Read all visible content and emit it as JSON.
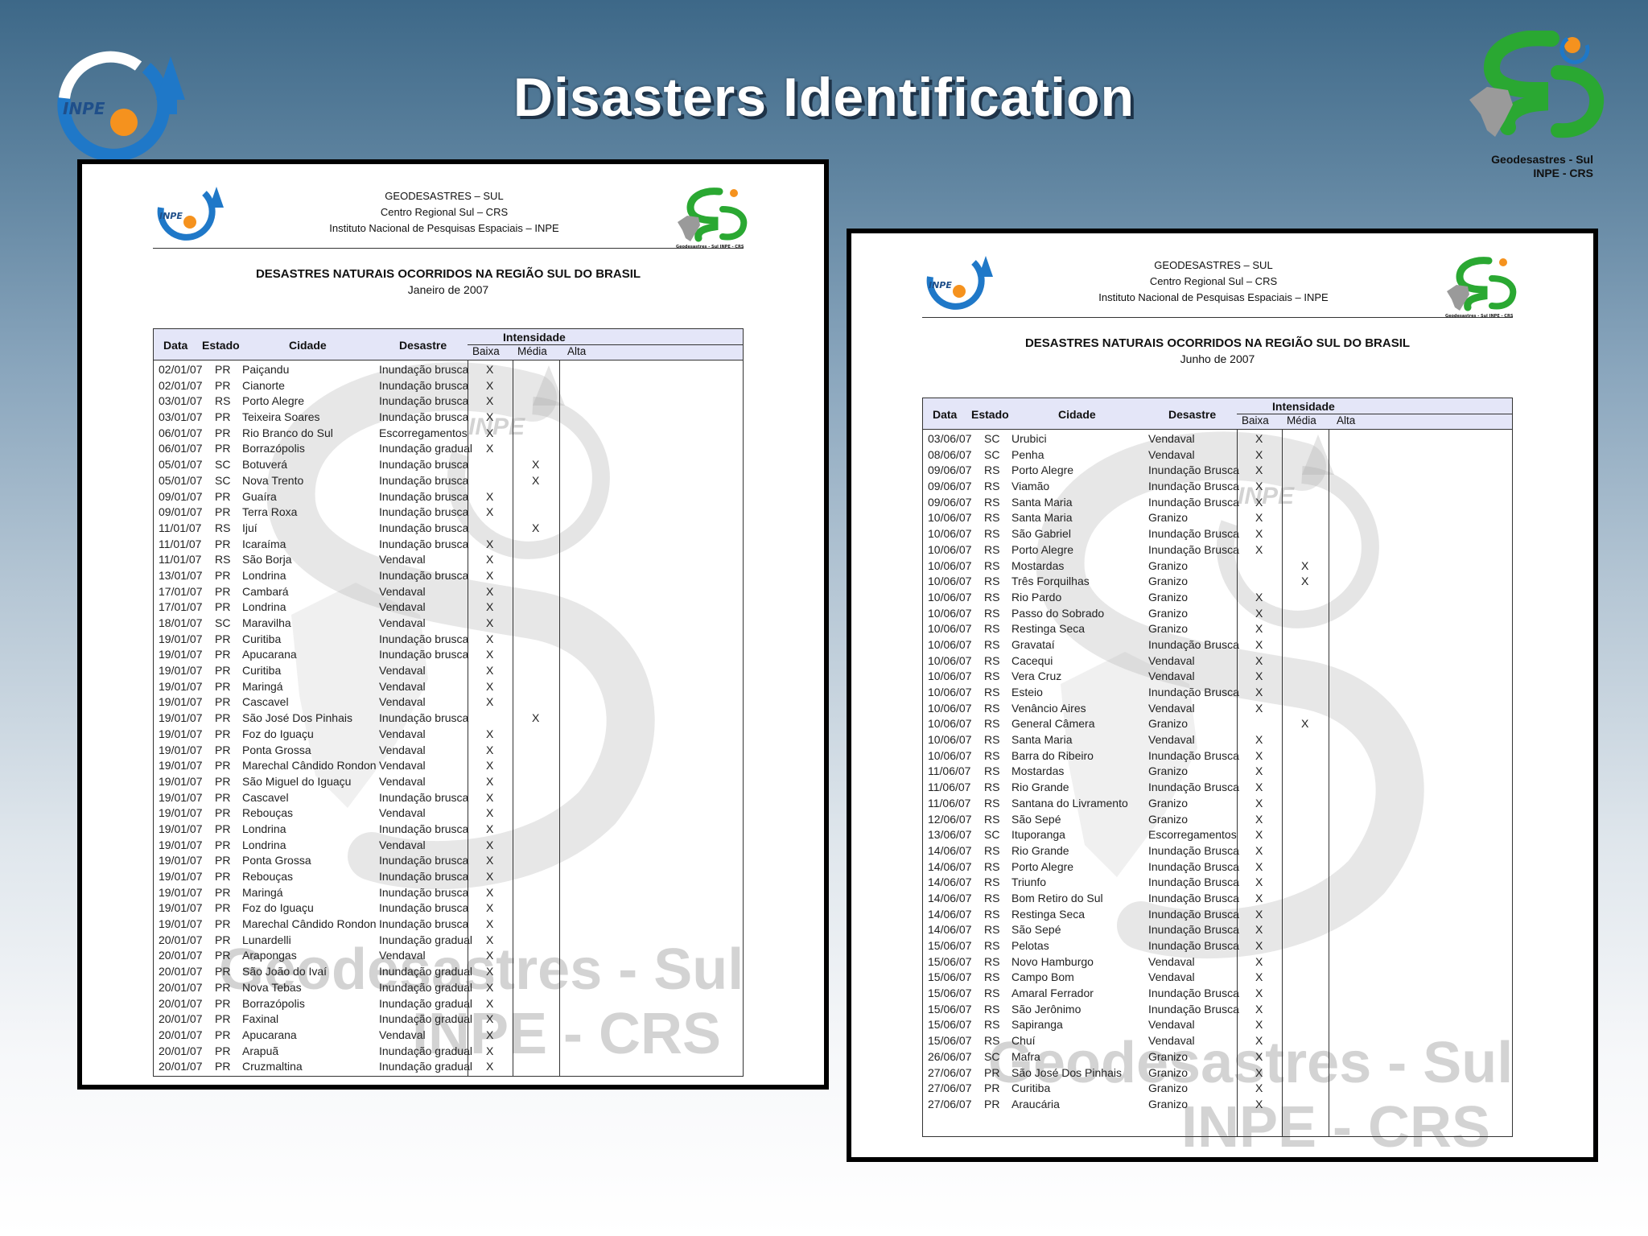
{
  "slide": {
    "title": "Disasters Identification",
    "logo_left": "INPE",
    "logo_right_caption": [
      "Geodesastres - Sul",
      "INPE - CRS"
    ]
  },
  "doc_header": {
    "logo_text": "INPE",
    "line1": "GEODESASTRES – SUL",
    "line2": "Centro Regional Sul – CRS",
    "line3": "Instituto Nacional de Pesquisas Espaciais – INPE",
    "logo_caption": "Geodesastres - Sul INPE - CRS",
    "title": "DESASTRES NATURAIS OCORRIDOS NA REGIÃO SUL DO BRASIL"
  },
  "table_header": {
    "data": "Data",
    "estado": "Estado",
    "cidade": "Cidade",
    "desastre": "Desastre",
    "intensidade": "Intensidade",
    "baixa": "Baixa",
    "media": "Média",
    "alta": "Alta"
  },
  "watermark": {
    "line1": "Geodesastres - Sul",
    "line2": "INPE - CRS",
    "small": "INPE"
  },
  "january": {
    "subtitle": "Janeiro de 2007",
    "rows": [
      [
        "02/01/07",
        "PR",
        "Paiçandu",
        "Inundação brusca",
        "X",
        "",
        ""
      ],
      [
        "02/01/07",
        "PR",
        "Cianorte",
        "Inundação brusca",
        "X",
        "",
        ""
      ],
      [
        "03/01/07",
        "RS",
        "Porto Alegre",
        "Inundação brusca",
        "X",
        "",
        ""
      ],
      [
        "03/01/07",
        "PR",
        "Teixeira Soares",
        "Inundação brusca",
        "X",
        "",
        ""
      ],
      [
        "06/01/07",
        "PR",
        "Rio Branco do Sul",
        "Escorregamentos",
        "X",
        "",
        ""
      ],
      [
        "06/01/07",
        "PR",
        "Borrazópolis",
        "Inundação gradual",
        "X",
        "",
        ""
      ],
      [
        "05/01/07",
        "SC",
        "Botuverá",
        "Inundação brusca",
        "",
        "X",
        ""
      ],
      [
        "05/01/07",
        "SC",
        "Nova Trento",
        "Inundação brusca",
        "",
        "X",
        ""
      ],
      [
        "09/01/07",
        "PR",
        "Guaíra",
        "Inundação brusca",
        "X",
        "",
        ""
      ],
      [
        "09/01/07",
        "PR",
        "Terra Roxa",
        "Inundação brusca",
        "X",
        "",
        ""
      ],
      [
        "11/01/07",
        "RS",
        "Ijuí",
        "Inundação brusca",
        "",
        "X",
        ""
      ],
      [
        "11/01/07",
        "PR",
        "Icaraíma",
        "Inundação brusca",
        "X",
        "",
        ""
      ],
      [
        "11/01/07",
        "RS",
        "São Borja",
        "Vendaval",
        "X",
        "",
        ""
      ],
      [
        "13/01/07",
        "PR",
        "Londrina",
        "Inundação brusca",
        "X",
        "",
        ""
      ],
      [
        "17/01/07",
        "PR",
        "Cambará",
        "Vendaval",
        "X",
        "",
        ""
      ],
      [
        "17/01/07",
        "PR",
        "Londrina",
        "Vendaval",
        "X",
        "",
        ""
      ],
      [
        "18/01/07",
        "SC",
        "Maravilha",
        "Vendaval",
        "X",
        "",
        ""
      ],
      [
        "19/01/07",
        "PR",
        "Curitiba",
        "Inundação brusca",
        "X",
        "",
        ""
      ],
      [
        "19/01/07",
        "PR",
        "Apucarana",
        "Inundação brusca",
        "X",
        "",
        ""
      ],
      [
        "19/01/07",
        "PR",
        "Curitiba",
        "Vendaval",
        "X",
        "",
        ""
      ],
      [
        "19/01/07",
        "PR",
        "Maringá",
        "Vendaval",
        "X",
        "",
        ""
      ],
      [
        "19/01/07",
        "PR",
        "Cascavel",
        "Vendaval",
        "X",
        "",
        ""
      ],
      [
        "19/01/07",
        "PR",
        "São José Dos Pinhais",
        "Inundação brusca",
        "",
        "X",
        ""
      ],
      [
        "19/01/07",
        "PR",
        "Foz do Iguaçu",
        "Vendaval",
        "X",
        "",
        ""
      ],
      [
        "19/01/07",
        "PR",
        "Ponta Grossa",
        "Vendaval",
        "X",
        "",
        ""
      ],
      [
        "19/01/07",
        "PR",
        "Marechal Cândido Rondon",
        "Vendaval",
        "X",
        "",
        ""
      ],
      [
        "19/01/07",
        "PR",
        "São Miguel do Iguaçu",
        "Vendaval",
        "X",
        "",
        ""
      ],
      [
        "19/01/07",
        "PR",
        "Cascavel",
        "Inundação brusca",
        "X",
        "",
        ""
      ],
      [
        "19/01/07",
        "PR",
        "Rebouças",
        "Vendaval",
        "X",
        "",
        ""
      ],
      [
        "19/01/07",
        "PR",
        "Londrina",
        "Inundação brusca",
        "X",
        "",
        ""
      ],
      [
        "19/01/07",
        "PR",
        "Londrina",
        "Vendaval",
        "X",
        "",
        ""
      ],
      [
        "19/01/07",
        "PR",
        "Ponta Grossa",
        "Inundação brusca",
        "X",
        "",
        ""
      ],
      [
        "19/01/07",
        "PR",
        "Rebouças",
        "Inundação brusca",
        "X",
        "",
        ""
      ],
      [
        "19/01/07",
        "PR",
        "Maringá",
        "Inundação brusca",
        "X",
        "",
        ""
      ],
      [
        "19/01/07",
        "PR",
        "Foz do Iguaçu",
        "Inundação brusca",
        "X",
        "",
        ""
      ],
      [
        "19/01/07",
        "PR",
        "Marechal Cândido Rondon",
        "Inundação brusca",
        "X",
        "",
        ""
      ],
      [
        "20/01/07",
        "PR",
        "Lunardelli",
        "Inundação gradual",
        "X",
        "",
        ""
      ],
      [
        "20/01/07",
        "PR",
        "Arapongas",
        "Vendaval",
        "X",
        "",
        ""
      ],
      [
        "20/01/07",
        "PR",
        "São João do Ivaí",
        "Inundação gradual",
        "X",
        "",
        ""
      ],
      [
        "20/01/07",
        "PR",
        "Nova Tebas",
        "Inundação gradual",
        "X",
        "",
        ""
      ],
      [
        "20/01/07",
        "PR",
        "Borrazópolis",
        "Inundação gradual",
        "X",
        "",
        ""
      ],
      [
        "20/01/07",
        "PR",
        "Faxinal",
        "Inundação gradual",
        "X",
        "",
        ""
      ],
      [
        "20/01/07",
        "PR",
        "Apucarana",
        "Vendaval",
        "X",
        "",
        ""
      ],
      [
        "20/01/07",
        "PR",
        "Arapuã",
        "Inundação gradual",
        "X",
        "",
        ""
      ],
      [
        "20/01/07",
        "PR",
        "Cruzmaltina",
        "Inundação gradual",
        "X",
        "",
        ""
      ]
    ]
  },
  "june": {
    "subtitle": "Junho de 2007",
    "rows": [
      [
        "03/06/07",
        "SC",
        "Urubici",
        "Vendaval",
        "X",
        "",
        ""
      ],
      [
        "08/06/07",
        "SC",
        "Penha",
        "Vendaval",
        "X",
        "",
        ""
      ],
      [
        "09/06/07",
        "RS",
        "Porto Alegre",
        "Inundação Brusca",
        "X",
        "",
        ""
      ],
      [
        "09/06/07",
        "RS",
        "Viamão",
        "Inundação Brusca",
        "X",
        "",
        ""
      ],
      [
        "09/06/07",
        "RS",
        "Santa Maria",
        "Inundação Brusca",
        "X",
        "",
        ""
      ],
      [
        "10/06/07",
        "RS",
        "Santa Maria",
        "Granizo",
        "X",
        "",
        ""
      ],
      [
        "10/06/07",
        "RS",
        "São Gabriel",
        "Inundação Brusca",
        "X",
        "",
        ""
      ],
      [
        "10/06/07",
        "RS",
        "Porto Alegre",
        "Inundação Brusca",
        "X",
        "",
        ""
      ],
      [
        "10/06/07",
        "RS",
        "Mostardas",
        "Granizo",
        "",
        "X",
        ""
      ],
      [
        "10/06/07",
        "RS",
        "Três Forquilhas",
        "Granizo",
        "",
        "X",
        ""
      ],
      [
        "10/06/07",
        "RS",
        "Rio Pardo",
        "Granizo",
        "X",
        "",
        ""
      ],
      [
        "10/06/07",
        "RS",
        "Passo do Sobrado",
        "Granizo",
        "X",
        "",
        ""
      ],
      [
        "10/06/07",
        "RS",
        "Restinga Seca",
        "Granizo",
        "X",
        "",
        ""
      ],
      [
        "10/06/07",
        "RS",
        "Gravataí",
        "Inundação Brusca",
        "X",
        "",
        ""
      ],
      [
        "10/06/07",
        "RS",
        "Cacequi",
        "Vendaval",
        "X",
        "",
        ""
      ],
      [
        "10/06/07",
        "RS",
        "Vera Cruz",
        "Vendaval",
        "X",
        "",
        ""
      ],
      [
        "10/06/07",
        "RS",
        "Esteio",
        "Inundação Brusca",
        "X",
        "",
        ""
      ],
      [
        "10/06/07",
        "RS",
        "Venâncio Aires",
        "Vendaval",
        "X",
        "",
        ""
      ],
      [
        "10/06/07",
        "RS",
        "General Câmera",
        "Granizo",
        "",
        "X",
        ""
      ],
      [
        "10/06/07",
        "RS",
        "Santa Maria",
        "Vendaval",
        "X",
        "",
        ""
      ],
      [
        "10/06/07",
        "RS",
        "Barra do Ribeiro",
        "Inundação Brusca",
        "X",
        "",
        ""
      ],
      [
        "11/06/07",
        "RS",
        "Mostardas",
        "Granizo",
        "X",
        "",
        ""
      ],
      [
        "11/06/07",
        "RS",
        "Rio Grande",
        "Inundação Brusca",
        "X",
        "",
        ""
      ],
      [
        "11/06/07",
        "RS",
        "Santana do Livramento",
        "Granizo",
        "X",
        "",
        ""
      ],
      [
        "12/06/07",
        "RS",
        "São Sepé",
        "Granizo",
        "X",
        "",
        ""
      ],
      [
        "13/06/07",
        "SC",
        "Ituporanga",
        "Escorregamentos",
        "X",
        "",
        ""
      ],
      [
        "14/06/07",
        "RS",
        "Rio Grande",
        "Inundação Brusca",
        "X",
        "",
        ""
      ],
      [
        "14/06/07",
        "RS",
        "Porto Alegre",
        "Inundação Brusca",
        "X",
        "",
        ""
      ],
      [
        "14/06/07",
        "RS",
        "Triunfo",
        "Inundação Brusca",
        "X",
        "",
        ""
      ],
      [
        "14/06/07",
        "RS",
        "Bom Retiro do Sul",
        "Inundação Brusca",
        "X",
        "",
        ""
      ],
      [
        "14/06/07",
        "RS",
        "Restinga Seca",
        "Inundação Brusca",
        "X",
        "",
        ""
      ],
      [
        "14/06/07",
        "RS",
        "São Sepé",
        "Inundação Brusca",
        "X",
        "",
        ""
      ],
      [
        "15/06/07",
        "RS",
        "Pelotas",
        "Inundação Brusca",
        "X",
        "",
        ""
      ],
      [
        "15/06/07",
        "RS",
        "Novo Hamburgo",
        "Vendaval",
        "X",
        "",
        ""
      ],
      [
        "15/06/07",
        "RS",
        "Campo Bom",
        "Vendaval",
        "X",
        "",
        ""
      ],
      [
        "15/06/07",
        "RS",
        "Amaral Ferrador",
        "Inundação Brusca",
        "X",
        "",
        ""
      ],
      [
        "15/06/07",
        "RS",
        "São Jerônimo",
        "Inundação Brusca",
        "X",
        "",
        ""
      ],
      [
        "15/06/07",
        "RS",
        "Sapiranga",
        "Vendaval",
        "X",
        "",
        ""
      ],
      [
        "15/06/07",
        "RS",
        "Chuí",
        "Vendaval",
        "X",
        "",
        ""
      ],
      [
        "26/06/07",
        "SC",
        "Mafra",
        "Granizo",
        "X",
        "",
        ""
      ],
      [
        "27/06/07",
        "PR",
        "São José Dos Pinhais",
        "Granizo",
        "X",
        "",
        ""
      ],
      [
        "27/06/07",
        "PR",
        "Curitiba",
        "Granizo",
        "X",
        "",
        ""
      ],
      [
        "27/06/07",
        "PR",
        "Araucária",
        "Granizo",
        "X",
        "",
        ""
      ]
    ]
  },
  "colors": {
    "title_shadow": "#1e3348",
    "table_header_bg": "#e4e6f8",
    "logo_blue": "#1f78c8",
    "logo_orange": "#f5921e",
    "logo_green": "#2aa832"
  }
}
